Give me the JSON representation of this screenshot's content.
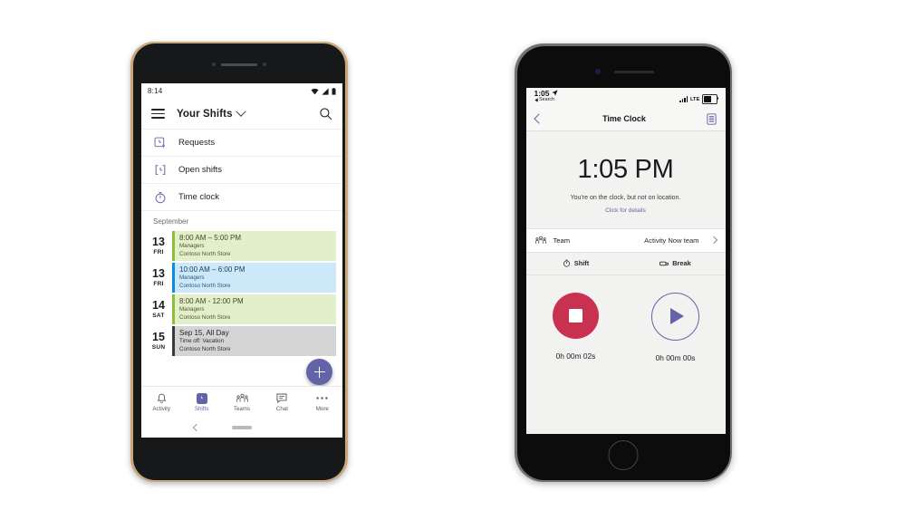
{
  "android": {
    "status_bar": {
      "time": "8:14",
      "icons": [
        "wifi-icon",
        "signal-icon",
        "battery-icon"
      ]
    },
    "app_bar": {
      "menu_icon": "hamburger-icon",
      "title": "Your Shifts",
      "dropdown_icon": "chevron-down-icon",
      "search_icon": "search-icon"
    },
    "menu_items": [
      {
        "label": "Requests",
        "icon": "clock-question-icon"
      },
      {
        "label": "Open shifts",
        "icon": "clock-bracket-icon"
      },
      {
        "label": "Time clock",
        "icon": "stopwatch-icon"
      }
    ],
    "month_header": "September",
    "shifts": [
      {
        "day": "13",
        "dow": "FRI",
        "time": "8:00 AM – 5:00 PM",
        "group": "Managers",
        "location": "Contoso North Store",
        "bg": "#e3eecb",
        "bar": "#8cbf3f",
        "text": "#3c4a1c"
      },
      {
        "day": "13",
        "dow": "FRI",
        "time": "10:00 AM – 6:00 PM",
        "group": "Managers",
        "location": "Contoso North Store",
        "bg": "#cde8f8",
        "bar": "#0c8ce9",
        "text": "#14415e"
      },
      {
        "day": "14",
        "dow": "SAT",
        "time": "8:00 AM - 12:00 PM",
        "group": "Managers",
        "location": "Contoso North Store",
        "bg": "#e3eecb",
        "bar": "#8cbf3f",
        "text": "#3c4a1c"
      },
      {
        "day": "15",
        "dow": "SUN",
        "time": "Sep 15, All Day",
        "group": "Time off: Vacation",
        "location": "Contoso North Store",
        "bg": "#d4d4d4",
        "bar": "#3a3a3c",
        "text": "#1f1f21"
      }
    ],
    "fab": {
      "icon": "plus-icon",
      "color": "#6264a7"
    },
    "tabs": [
      {
        "label": "Activity",
        "icon": "bell-icon",
        "active": false
      },
      {
        "label": "Shifts",
        "icon": "shifts-clock-icon",
        "active": true
      },
      {
        "label": "Teams",
        "icon": "teams-people-icon",
        "active": false
      },
      {
        "label": "Chat",
        "icon": "chat-bubble-icon",
        "active": false
      },
      {
        "label": "More",
        "icon": "ellipsis-icon",
        "active": false
      }
    ],
    "gesture_bar": {
      "back_icon": "back-chevron-icon",
      "pill": "home-pill"
    }
  },
  "iphone": {
    "status_bar": {
      "time": "1:05",
      "location_icon": "location-arrow-icon",
      "back_app": "Search",
      "carrier": "LTE",
      "signal_icon": "signal-bars-icon",
      "battery_icon": "battery-icon"
    },
    "nav_bar": {
      "back_icon": "back-chevron-icon",
      "title": "Time Clock",
      "right_icon": "timesheet-document-icon"
    },
    "clock": {
      "time": "1:05 PM",
      "status_message": "You're on the clock, but not on location.",
      "details_link": "Click for details"
    },
    "team_row": {
      "icon": "people-icon",
      "label": "Team",
      "value": "Activity Now team",
      "chevron": "chevron-right-icon"
    },
    "controls": {
      "headers": [
        {
          "label": "Shift",
          "icon": "stopwatch-icon"
        },
        {
          "label": "Break",
          "icon": "break-icon"
        }
      ],
      "shift": {
        "button_icon": "stop-icon",
        "button_color": "#c8314f",
        "elapsed": "0h 00m 02s"
      },
      "break": {
        "button_icon": "play-icon",
        "button_color": "#6264a7",
        "elapsed": "0h 00m 00s"
      }
    }
  }
}
